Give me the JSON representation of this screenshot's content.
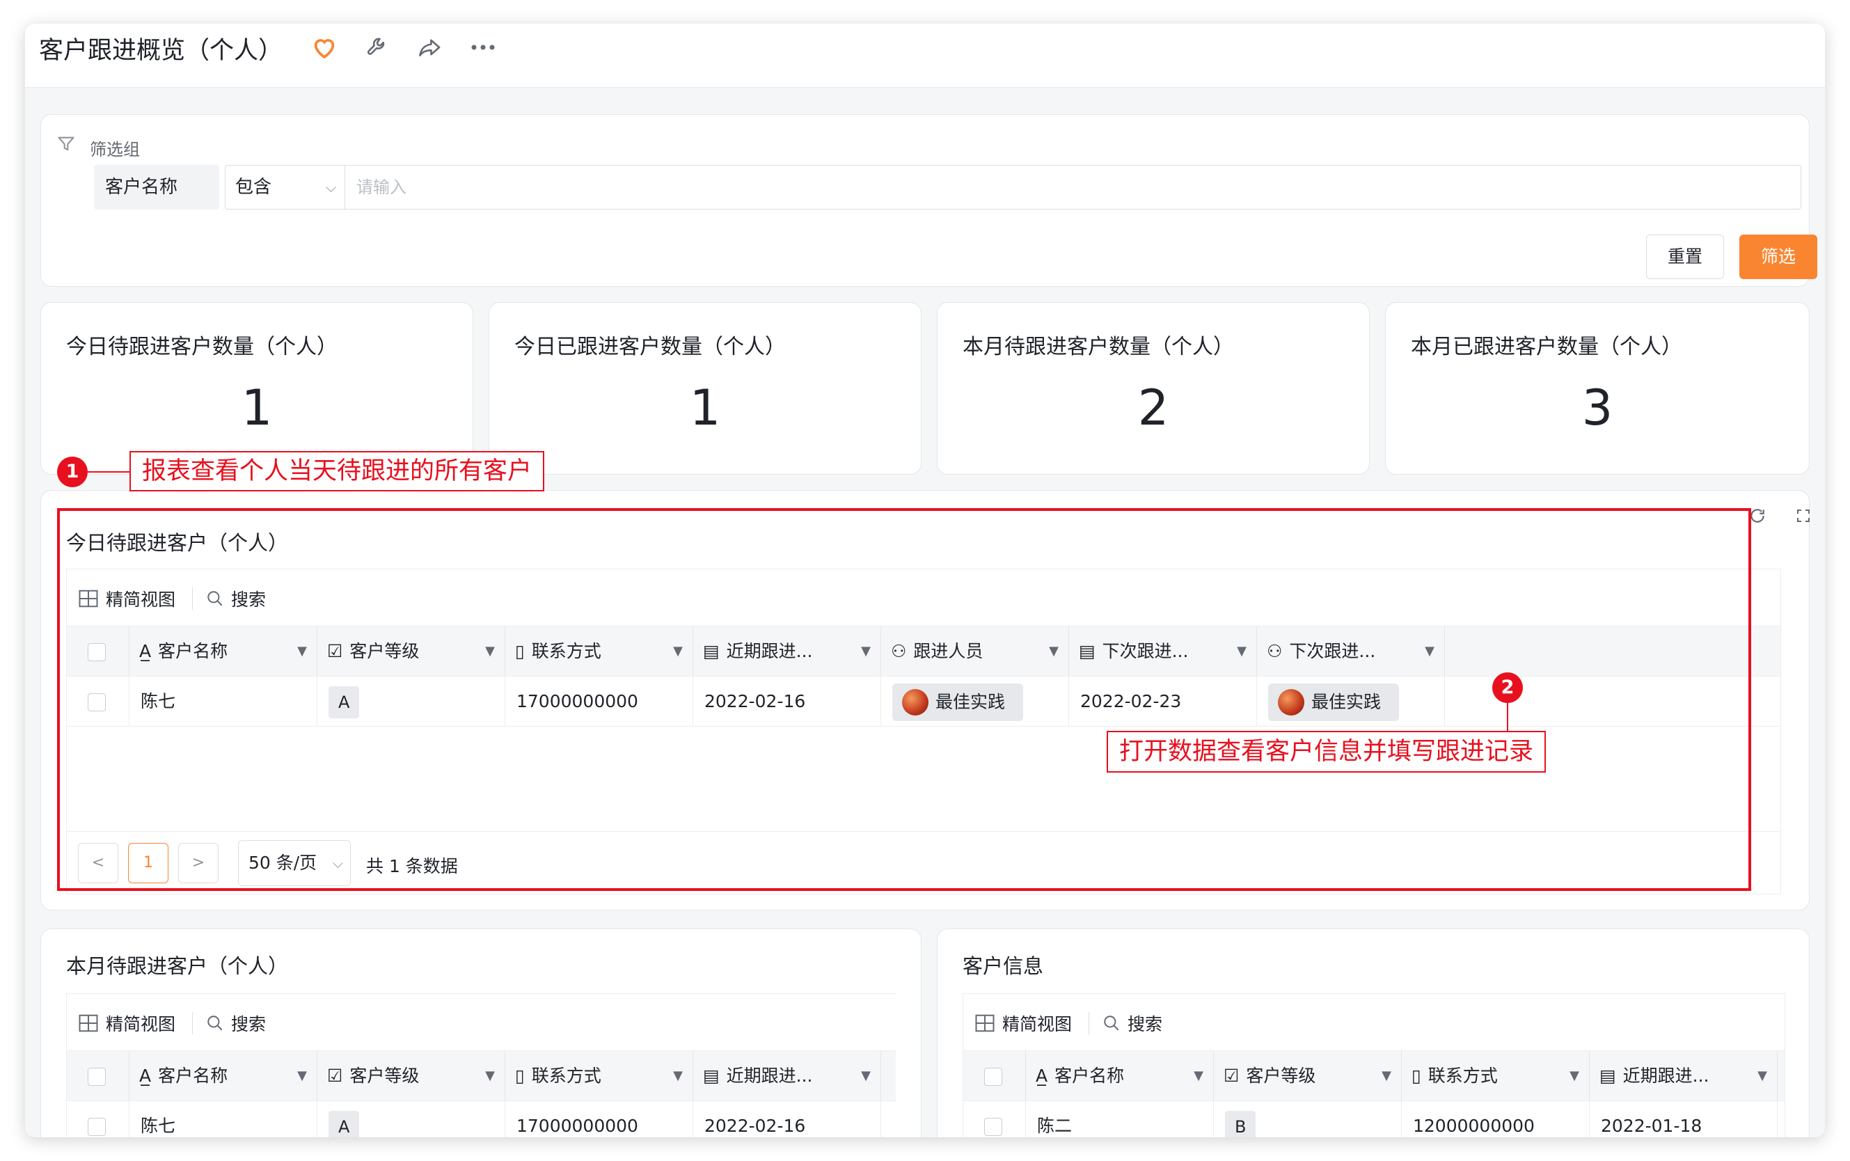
{
  "header": {
    "title": "客户跟进概览（个人）"
  },
  "filter": {
    "group_label": "筛选组",
    "field": "客户名称",
    "operator": "包含",
    "placeholder": "请输入",
    "reset_label": "重置",
    "filter_label": "筛选"
  },
  "stats": [
    {
      "title": "今日待跟进客户数量（个人）",
      "value": "1"
    },
    {
      "title": "今日已跟进客户数量（个人）",
      "value": "1"
    },
    {
      "title": "本月待跟进客户数量（个人）",
      "value": "2"
    },
    {
      "title": "本月已跟进客户数量（个人）",
      "value": "3"
    }
  ],
  "toolbar": {
    "view_label": "精简视图",
    "search_label": "搜索"
  },
  "today_table": {
    "title": "今日待跟进客户（个人）",
    "columns": [
      "客户名称",
      "客户等级",
      "联系方式",
      "近期跟进...",
      "跟进人员",
      "下次跟进...",
      "下次跟进..."
    ],
    "rows": [
      {
        "name": "陈七",
        "level": "A",
        "phone": "17000000000",
        "recent": "2022-02-16",
        "follower": "最佳实践",
        "next_date": "2022-02-23",
        "next_person": "最佳实践"
      }
    ],
    "pager": {
      "prev": "<",
      "current": "1",
      "next": ">",
      "size": "50 条/页",
      "total": "共 1 条数据"
    }
  },
  "month_table": {
    "title": "本月待跟进客户（个人）",
    "columns": [
      "客户名称",
      "客户等级",
      "联系方式",
      "近期跟进..."
    ],
    "rows": [
      {
        "name": "陈七",
        "level": "A",
        "phone": "17000000000",
        "recent": "2022-02-16"
      }
    ]
  },
  "info_table": {
    "title": "客户信息",
    "columns": [
      "客户名称",
      "客户等级",
      "联系方式",
      "近期跟进..."
    ],
    "rows": [
      {
        "name": "陈二",
        "level": "B",
        "phone": "12000000000",
        "recent": "2022-01-18"
      }
    ]
  },
  "annotations": {
    "a1_num": "1",
    "a1_text": "报表查看个人当天待跟进的所有客户",
    "a2_num": "2",
    "a2_text": "打开数据查看客户信息并填写跟进记录"
  },
  "colors": {
    "accent": "#fa8531",
    "annotation": "#e8101e"
  }
}
